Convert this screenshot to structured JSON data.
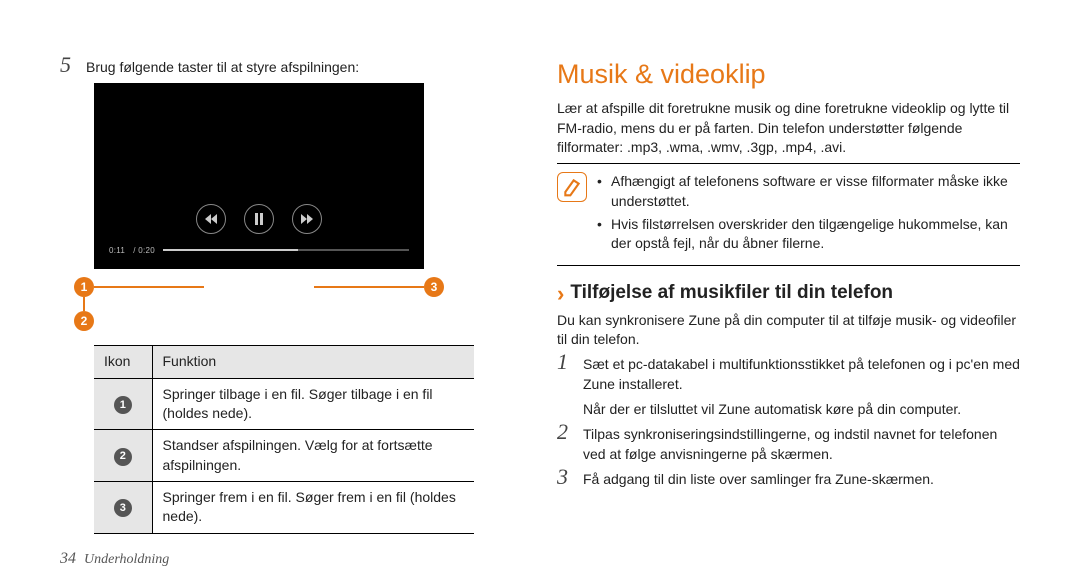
{
  "left": {
    "step5_num": "5",
    "step5_text": "Brug følgende taster til at styre afspilningen:",
    "player": {
      "time_current": "0:11",
      "time_total": "/ 0:20",
      "btn_prev": "prev-icon",
      "btn_pause": "pause-icon",
      "btn_next": "next-icon"
    },
    "markers": {
      "m1": "1",
      "m2": "2",
      "m3": "3"
    },
    "table": {
      "head_icon": "Ikon",
      "head_func": "Funktion",
      "rows": [
        {
          "n": "1",
          "text": "Springer tilbage i en fil. Søger tilbage i en fil (holdes nede)."
        },
        {
          "n": "2",
          "text": "Standser afspilningen. Vælg        for at fortsætte afspilningen."
        },
        {
          "n": "3",
          "text": "Springer frem i en fil. Søger frem i en fil (holdes nede)."
        }
      ]
    }
  },
  "right": {
    "title": "Musik & videoklip",
    "intro": "Lær at afspille dit foretrukne musik og dine foretrukne videoklip og lytte til FM-radio, mens du er på farten. Din telefon understøtter følgende filformater: .mp3, .wma, .wmv, .3gp, .mp4, .avi.",
    "note1": "Afhængigt af telefonens software er visse filformater måske ikke understøttet.",
    "note2": "Hvis filstørrelsen overskrider den tilgængelige hukommelse, kan der opstå fejl, når du åbner filerne.",
    "subheading": "Tilføjelse af musikfiler til din telefon",
    "sub_intro": "Du kan synkronisere Zune på din computer til at tilføje musik- og videofiler til din telefon.",
    "steps": [
      {
        "n": "1",
        "text": "Sæt et pc-datakabel i multifunktionsstikket på telefonen og i pc'en med Zune installeret.",
        "extra": "Når der er tilsluttet vil Zune automatisk køre på din computer."
      },
      {
        "n": "2",
        "text": "Tilpas synkroniseringsindstillingerne, og indstil navnet for telefonen ved at følge anvisningerne på skærmen."
      },
      {
        "n": "3",
        "text": "Få adgang til din liste over samlinger fra Zune-skærmen."
      }
    ]
  },
  "footer": {
    "page": "34",
    "section": "Underholdning"
  }
}
